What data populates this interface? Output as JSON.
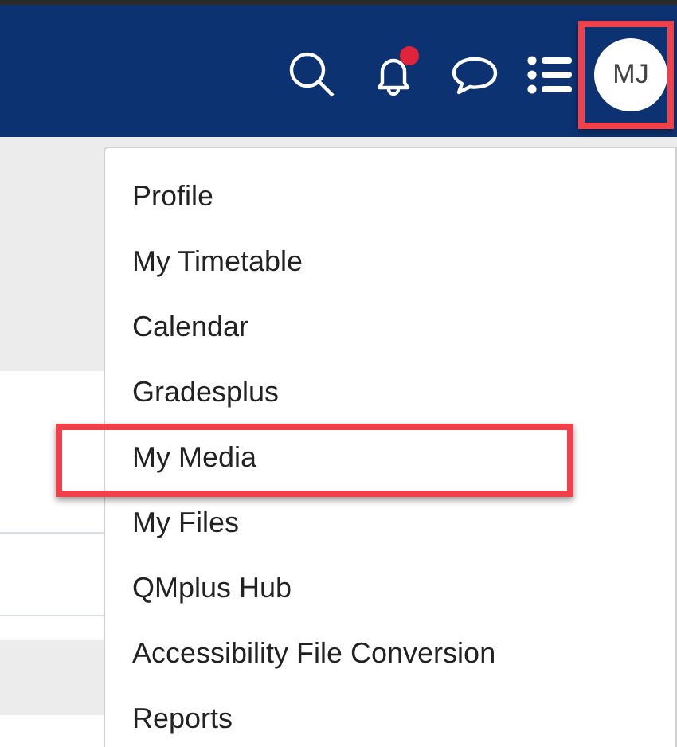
{
  "header": {
    "notification_dot": true,
    "avatar": {
      "initials": "MJ",
      "highlighted": true
    }
  },
  "menu": {
    "items": [
      {
        "label": "Profile",
        "highlighted": false
      },
      {
        "label": "My Timetable",
        "highlighted": false
      },
      {
        "label": "Calendar",
        "highlighted": false
      },
      {
        "label": "Gradesplus",
        "highlighted": false
      },
      {
        "label": "My Media",
        "highlighted": true
      },
      {
        "label": "My Files",
        "highlighted": false
      },
      {
        "label": "QMplus Hub",
        "highlighted": false
      },
      {
        "label": "Accessibility File Conversion",
        "highlighted": false
      },
      {
        "label": "Reports",
        "highlighted": false
      }
    ]
  }
}
